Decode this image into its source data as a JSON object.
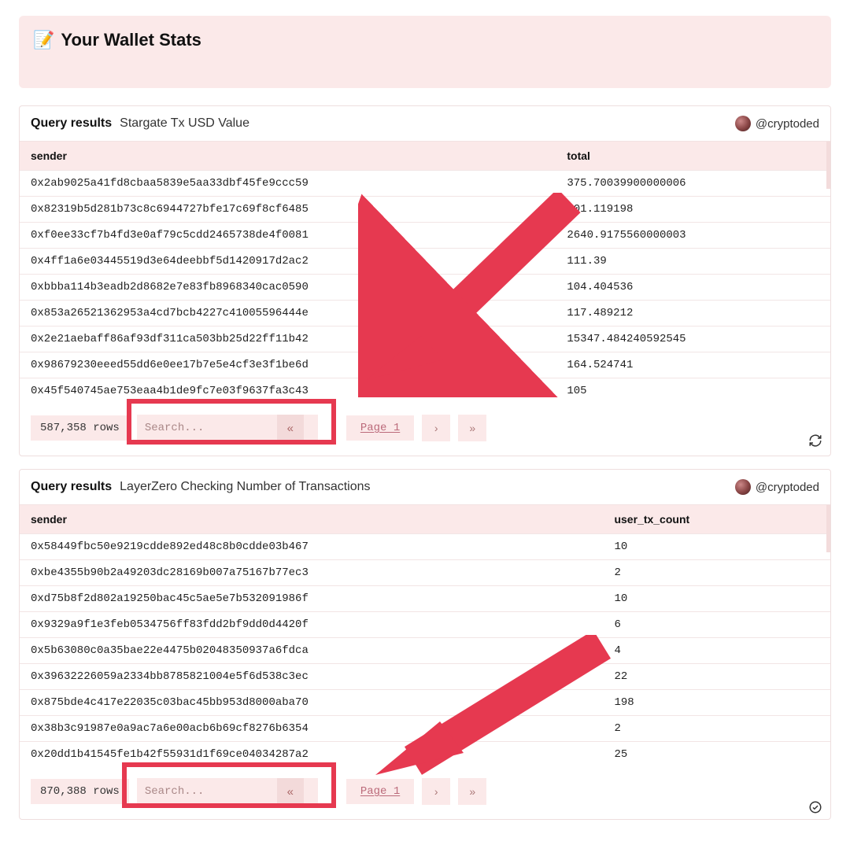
{
  "header": {
    "icon": "📝",
    "title": "Your Wallet Stats"
  },
  "panels": [
    {
      "query_label": "Query results",
      "query_name": "Stargate Tx USD Value",
      "author": "@cryptoded",
      "columns": {
        "c0": "sender",
        "c1": "total"
      },
      "rows": [
        {
          "sender": "0x2ab9025a41fd8cbaa5839e5aa33dbf45fe9ccc59",
          "total": "375.70039900000006"
        },
        {
          "sender": "0x82319b5d281b73c8c6944727bfe17c69f8cf6485",
          "total": "301.119198"
        },
        {
          "sender": "0xf0ee33cf7b4fd3e0af79c5cdd2465738de4f0081",
          "total": "2640.9175560000003"
        },
        {
          "sender": "0x4ff1a6e03445519d3e64deebbf5d1420917d2ac2",
          "total": "111.39"
        },
        {
          "sender": "0xbbba114b3eadb2d8682e7e83fb8968340cac0590",
          "total": "104.404536"
        },
        {
          "sender": "0x853a26521362953a4cd7bcb4227c41005596444e",
          "total": "117.489212"
        },
        {
          "sender": "0x2e21aebaff86af93df311ca503bb25d22ff11b42",
          "total": "15347.484240592545"
        },
        {
          "sender": "0x98679230eeed55dd6e0ee17b7e5e4cf3e3f1be6d",
          "total": "164.524741"
        },
        {
          "sender": "0x45f540745ae753eaa4b1de9fc7e03f9637fa3c43",
          "total": "105"
        }
      ],
      "row_count": "587,358 rows",
      "search_placeholder": "Search...",
      "page_label": "Page 1",
      "footer_icon": "refresh"
    },
    {
      "query_label": "Query results",
      "query_name": "LayerZero Checking Number of Transactions",
      "author": "@cryptoded",
      "columns": {
        "c0": "sender",
        "c1": "user_tx_count"
      },
      "rows": [
        {
          "sender": "0x58449fbc50e9219cdde892ed48c8b0cdde03b467",
          "total": "10"
        },
        {
          "sender": "0xbe4355b90b2a49203dc28169b007a75167b77ec3",
          "total": "2"
        },
        {
          "sender": "0xd75b8f2d802a19250bac45c5ae5e7b532091986f",
          "total": "10"
        },
        {
          "sender": "0x9329a9f1e3feb0534756ff83fdd2bf9dd0d4420f",
          "total": "6"
        },
        {
          "sender": "0x5b63080c0a35bae22e4475b02048350937a6fdca",
          "total": "4"
        },
        {
          "sender": "0x39632226059a2334bb8785821004e5f6d538c3ec",
          "total": "22"
        },
        {
          "sender": "0x875bde4c417e22035c03bac45bb953d8000aba70",
          "total": "198"
        },
        {
          "sender": "0x38b3c91987e0a9ac7a6e00acb6b69cf8276b6354",
          "total": "2"
        },
        {
          "sender": "0x20dd1b41545fe1b42f55931d1f69ce04034287a2",
          "total": "25"
        }
      ],
      "row_count": "870,388 rows",
      "search_placeholder": "Search...",
      "page_label": "Page 1",
      "footer_icon": "check"
    }
  ],
  "annotation_color": "#e63950"
}
